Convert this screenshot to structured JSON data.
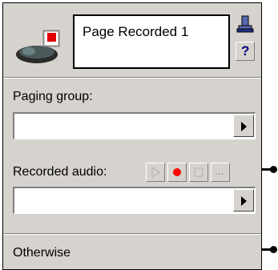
{
  "node": {
    "title": "Page Recorded 1",
    "icon": "voice-node-icon",
    "help_label": "?",
    "pin_icon": "pin-icon"
  },
  "paging_group": {
    "label": "Paging group:",
    "value": ""
  },
  "recorded_audio": {
    "label": "Recorded audio:",
    "value": "",
    "buttons": {
      "play": "play-icon",
      "record": "record-icon",
      "stop": "stop-icon",
      "browse": "..."
    }
  },
  "otherwise": {
    "label": "Otherwise"
  },
  "colors": {
    "panel_bg": "#d6d3ce",
    "record_red": "#ff0000",
    "help_blue": "#000080"
  }
}
